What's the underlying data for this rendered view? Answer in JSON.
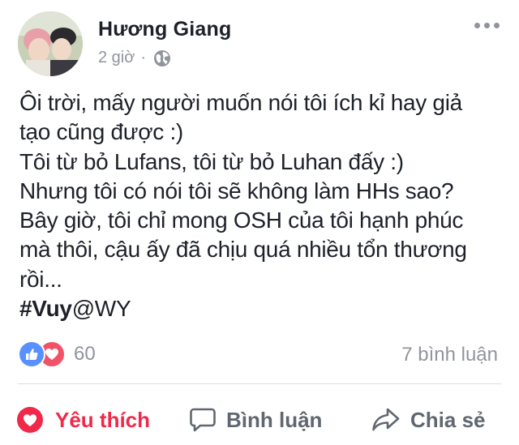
{
  "post": {
    "author": "Hương Giang",
    "time": "2 giờ",
    "separator": "·",
    "privacy_icon": "globe-icon",
    "menu_icon": "more-options-icon",
    "lines": [
      "Ôi trời, mấy người muốn nói tôi ích kỉ hay giả",
      "tạo cũng được :)",
      "Tôi từ bỏ Lufans, tôi từ bỏ Luhan đấy :)",
      "Nhưng tôi có nói tôi sẽ không làm HHs sao?",
      "Bây giờ, tôi chỉ mong OSH của tôi hạnh phúc",
      "mà thôi, cậu ấy đã chịu quá nhiều tổn thương",
      "rồi..."
    ],
    "hashtag": "#Vuy",
    "mention": "@WY"
  },
  "stats": {
    "reaction_count": "60",
    "comments": "7 bình luận",
    "reaction_icons": [
      "like-reaction-icon",
      "love-reaction-icon"
    ]
  },
  "actions": {
    "like_label": "Yêu thích",
    "comment_label": "Bình luận",
    "share_label": "Chia sẻ"
  },
  "colors": {
    "love_active": "#f0284a",
    "like_blue": "#5890ff",
    "love_red": "#f25268",
    "secondary_text": "#90949c",
    "action_gray": "#606770"
  }
}
